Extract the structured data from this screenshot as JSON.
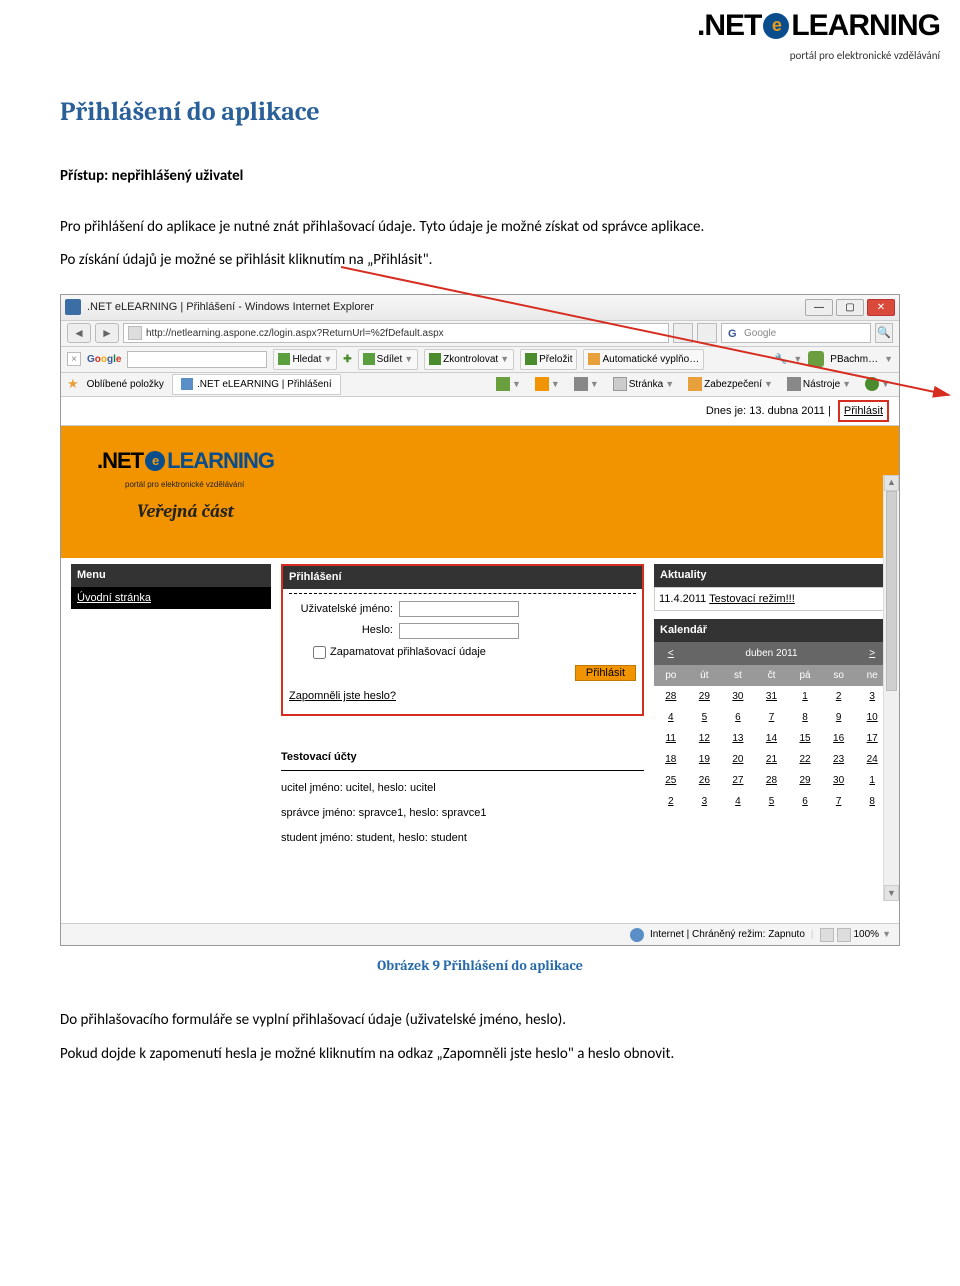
{
  "header_logo": {
    "net": ".NET",
    "e": "e",
    "learn": "LEARNING",
    "sub": "portál pro elektronické vzdělávání"
  },
  "title": "Přihlášení do aplikace",
  "access_line": "Přístup: nepřihlášený uživatel",
  "para1": "Pro přihlášení do aplikace je nutné znát přihlašovací údaje. Tyto údaje je možné získat od správce aplikace.",
  "para2": "Po získání údajů je možné se přihlásit kliknutím na „Přihlásit\".",
  "browser": {
    "title": ".NET eLEARNING | Přihlášení - Windows Internet Explorer",
    "url": "http://netlearning.aspone.cz/login.aspx?ReturnUrl=%2fDefault.aspx",
    "search_placeholder": "Google",
    "google_label": "Google",
    "toolbar": {
      "hledat": "Hledat",
      "sdilet": "Sdílet",
      "zkontrolovat": "Zkontrolovat",
      "prelozit": "Přeložit",
      "auto": "Automatické vyplňo…",
      "user": "PBachm…"
    },
    "favbar": {
      "fav": "Oblíbené položky",
      "tab": ".NET eLEARNING | Přihlášení",
      "stranka": "Stránka",
      "zabezpeceni": "Zabezpečení",
      "nastroje": "Nástroje"
    },
    "datebar": {
      "dnes": "Dnes je: 13. dubna 2011",
      "login": "Přihlásit"
    },
    "orange": {
      "vc": "Veřejná část",
      "logo_sub": "portál pro elektronické vzdělávání"
    },
    "menu": {
      "hdr": "Menu",
      "item": "Úvodní stránka"
    },
    "login": {
      "hdr": "Přihlášení",
      "user": "Uživatelské jméno:",
      "pass": "Heslo:",
      "remember": "Zapamatovat přihlašovací údaje",
      "btn": "Přihlásit",
      "forgot": "Zapomněli jste heslo?"
    },
    "test": {
      "hdr": "Testovací účty",
      "l1": "ucitel jméno: ucitel, heslo: ucitel",
      "l2": "správce jméno: spravce1, heslo: spravce1",
      "l3": "student jméno: student, heslo: student"
    },
    "aktuality": {
      "hdr": "Aktuality",
      "date": "11.4.2011",
      "link": "Testovací režim!!!"
    },
    "cal": {
      "hdr": "Kalendář",
      "prev": "<",
      "month": "duben 2011",
      "next": ">",
      "days": [
        "po",
        "út",
        "st",
        "čt",
        "pá",
        "so",
        "ne"
      ],
      "rows": [
        [
          "28",
          "29",
          "30",
          "31",
          "1",
          "2",
          "3"
        ],
        [
          "4",
          "5",
          "6",
          "7",
          "8",
          "9",
          "10"
        ],
        [
          "11",
          "12",
          "13",
          "14",
          "15",
          "16",
          "17"
        ],
        [
          "18",
          "19",
          "20",
          "21",
          "22",
          "23",
          "24"
        ],
        [
          "25",
          "26",
          "27",
          "28",
          "29",
          "30",
          "1"
        ],
        [
          "2",
          "3",
          "4",
          "5",
          "6",
          "7",
          "8"
        ]
      ]
    },
    "status": {
      "mode": "Internet | Chráněný režim: Zapnuto",
      "zoom": "100%"
    }
  },
  "caption": "Obrázek 9 Přihlášení do aplikace",
  "para3": "Do přihlašovacího formuláře se vyplní přihlašovací údaje (uživatelské jméno, heslo).",
  "para4": "Pokud dojde k zapomenutí hesla je možné kliknutím na odkaz „Zapomněli jste heslo\" a heslo obnovit."
}
